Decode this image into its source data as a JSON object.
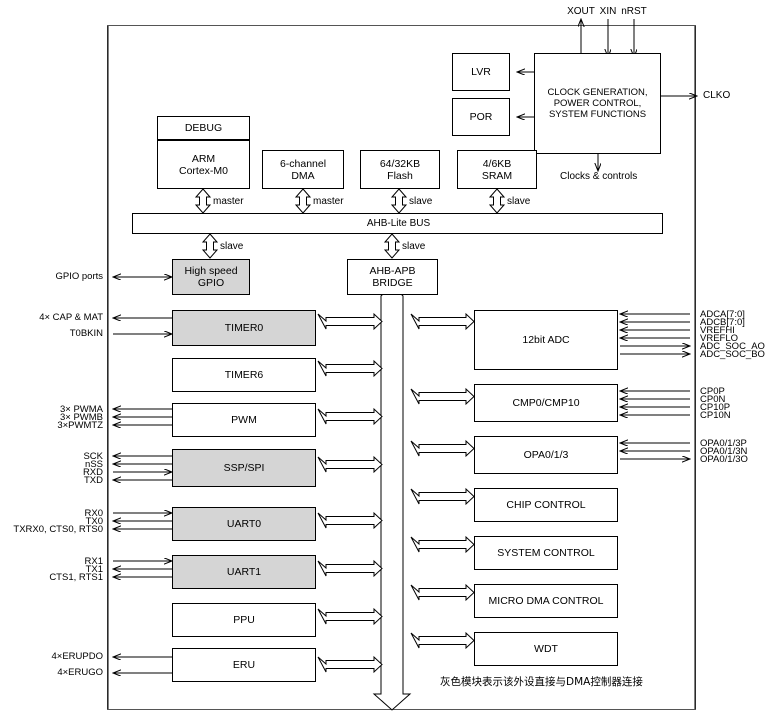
{
  "diagram": {
    "title": "MCU block diagram",
    "caption_cn": "灰色模块表示该外设直接与DMA控制器连接",
    "colors": {
      "gray_block": "#d5d5d5",
      "line": "#000000",
      "background": "#ffffff"
    }
  },
  "top_pins": {
    "xout": "XOUT",
    "xin": "XIN",
    "nrst": "nRST"
  },
  "core": {
    "debug": "DEBUG",
    "cpu_line1": "ARM",
    "cpu_line2": "Cortex-M0",
    "dma_line1": "6-channel",
    "dma_line2": "DMA",
    "flash_line1": "64/32KB",
    "flash_line2": "Flash",
    "sram_line1": "4/6KB",
    "sram_line2": "SRAM",
    "master_label": "master",
    "slave_label": "slave"
  },
  "power": {
    "lvr": "LVR",
    "por": "POR",
    "clock_line1": "CLOCK GENERATION,",
    "clock_line2": "POWER CONTROL,",
    "clock_line3": "SYSTEM FUNCTIONS",
    "clocks_controls": "Clocks & controls",
    "clko": "CLKO"
  },
  "buses": {
    "ahb": "AHB-Lite BUS",
    "bridge_line1": "AHB-APB",
    "bridge_line2": "BRIDGE"
  },
  "left_column_blocks": [
    {
      "label": "High speed\nGPIO",
      "line1": "High speed",
      "line2": "GPIO",
      "gray": true
    },
    {
      "label": "TIMER0",
      "line1": "TIMER0",
      "line2": "",
      "gray": true
    },
    {
      "label": "TIMER6",
      "line1": "TIMER6",
      "line2": "",
      "gray": false
    },
    {
      "label": "PWM",
      "line1": "PWM",
      "line2": "",
      "gray": false
    },
    {
      "label": "SSP/SPI",
      "line1": "SSP/SPI",
      "line2": "",
      "gray": true
    },
    {
      "label": "UART0",
      "line1": "UART0",
      "line2": "",
      "gray": true
    },
    {
      "label": "UART1",
      "line1": "UART1",
      "line2": "",
      "gray": true
    },
    {
      "label": "PPU",
      "line1": "PPU",
      "line2": "",
      "gray": false
    },
    {
      "label": "ERU",
      "line1": "ERU",
      "line2": "",
      "gray": false
    }
  ],
  "right_column_blocks": [
    {
      "label": "12bit ADC"
    },
    {
      "label": "CMP0/CMP10"
    },
    {
      "label": "OPA0/1/3"
    },
    {
      "label": "CHIP CONTROL"
    },
    {
      "label": "SYSTEM CONTROL"
    },
    {
      "label": "MICRO DMA CONTROL"
    },
    {
      "label": "WDT"
    }
  ],
  "left_signals": [
    {
      "text": "GPIO ports"
    },
    {
      "text": "4× CAP & MAT"
    },
    {
      "text": "T0BKIN"
    },
    {
      "text": "3× PWMA"
    },
    {
      "text": "3× PWMB"
    },
    {
      "text": "3×PWMTZ"
    },
    {
      "text": "SCK"
    },
    {
      "text": "nSS"
    },
    {
      "text": "RXD"
    },
    {
      "text": "TXD"
    },
    {
      "text": "RX0"
    },
    {
      "text": "TX0"
    },
    {
      "text": "TXRX0, CTS0, RTS0"
    },
    {
      "text": "RX1"
    },
    {
      "text": "TX1"
    },
    {
      "text": "CTS1, RTS1"
    },
    {
      "text": "4×ERUPDO"
    },
    {
      "text": "4×ERUGO"
    }
  ],
  "right_signals": [
    {
      "text": "ADCA[7:0]"
    },
    {
      "text": "ADCB[7:0]"
    },
    {
      "text": "VREFHI"
    },
    {
      "text": "VREFLO"
    },
    {
      "text": "ADC_SOC_AO"
    },
    {
      "text": "ADC_SOC_BO"
    },
    {
      "text": "CP0P"
    },
    {
      "text": "CP0N"
    },
    {
      "text": "CP10P"
    },
    {
      "text": "CP10N"
    },
    {
      "text": "OPA0/1/3P"
    },
    {
      "text": "OPA0/1/3N"
    },
    {
      "text": "OPA0/1/3O"
    }
  ]
}
